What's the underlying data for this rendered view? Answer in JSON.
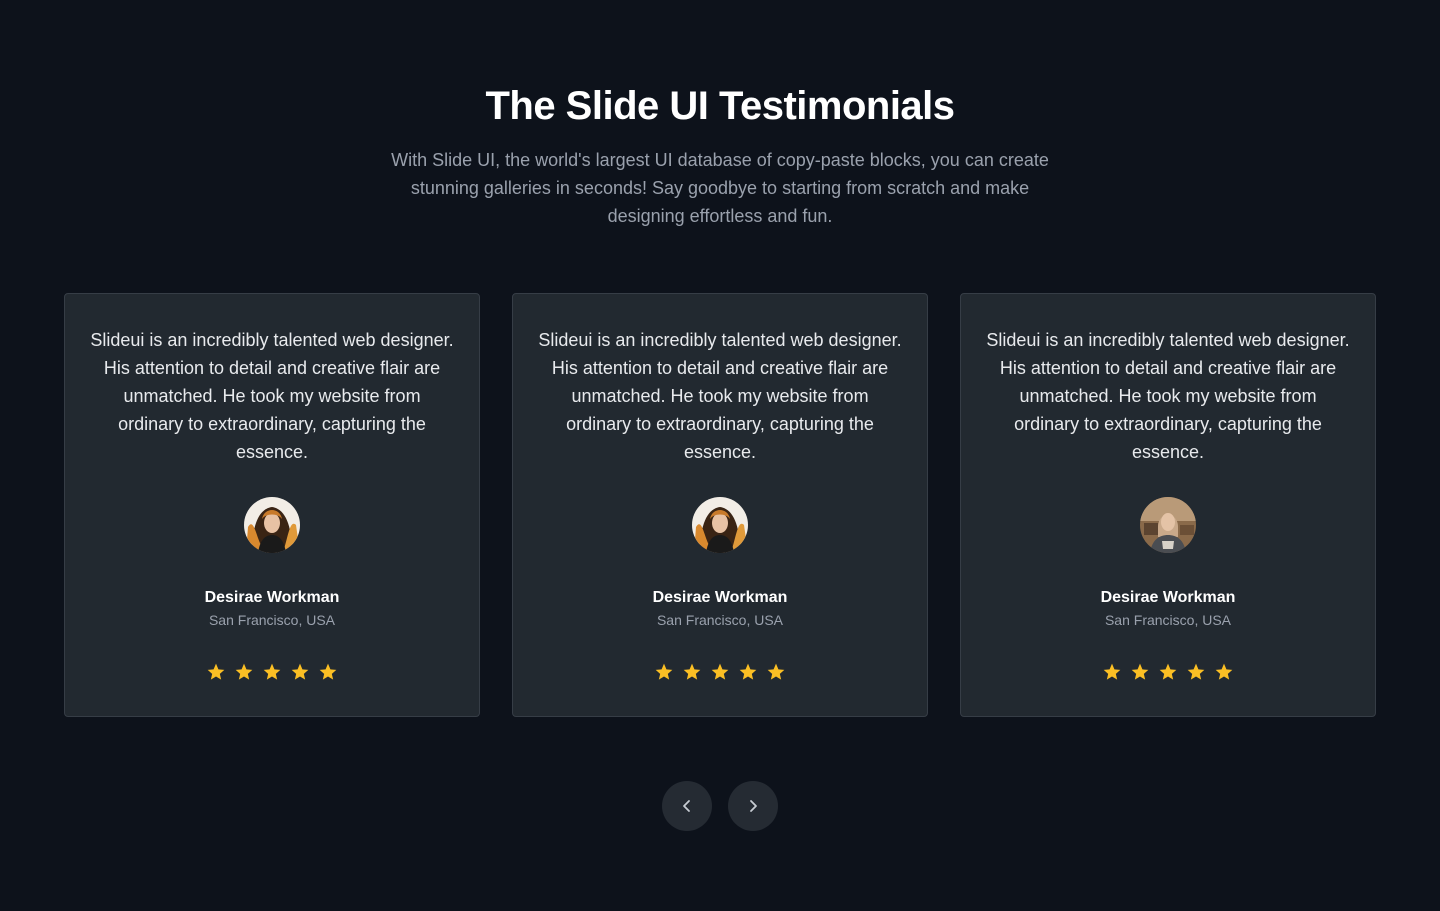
{
  "header": {
    "title": "The Slide UI Testimonials",
    "subtitle": "With Slide UI, the world's largest UI database of copy-paste blocks, you can create stunning galleries in seconds! Say goodbye to starting from scratch and make designing effortless and fun."
  },
  "testimonials": [
    {
      "quote": "Slideui is an incredibly talented web designer. His attention to detail and creative flair are unmatched. He took my website from ordinary to extraordinary, capturing the essence.",
      "name": "Desirae Workman",
      "location": "San Francisco, USA",
      "rating": 5,
      "avatar": "woman-with-flowing-hair-portrait"
    },
    {
      "quote": "Slideui is an incredibly talented web designer. His attention to detail and creative flair are unmatched. He took my website from ordinary to extraordinary, capturing the essence.",
      "name": "Desirae Workman",
      "location": "San Francisco, USA",
      "rating": 5,
      "avatar": "woman-with-flowing-hair-portrait"
    },
    {
      "quote": "Slideui is an incredibly talented web designer. His attention to detail and creative flair are unmatched. He took my website from ordinary to extraordinary, capturing the essence.",
      "name": "Desirae Workman",
      "location": "San Francisco, USA",
      "rating": 5,
      "avatar": "woman-in-kitchen-portrait"
    }
  ],
  "navigation": {
    "prev_icon": "chevron-left-icon",
    "next_icon": "chevron-right-icon"
  },
  "colors": {
    "background": "#0d121b",
    "card": "#222930",
    "card_border": "#363d46",
    "star": "#fbbf24",
    "nav_button": "#252b33"
  }
}
